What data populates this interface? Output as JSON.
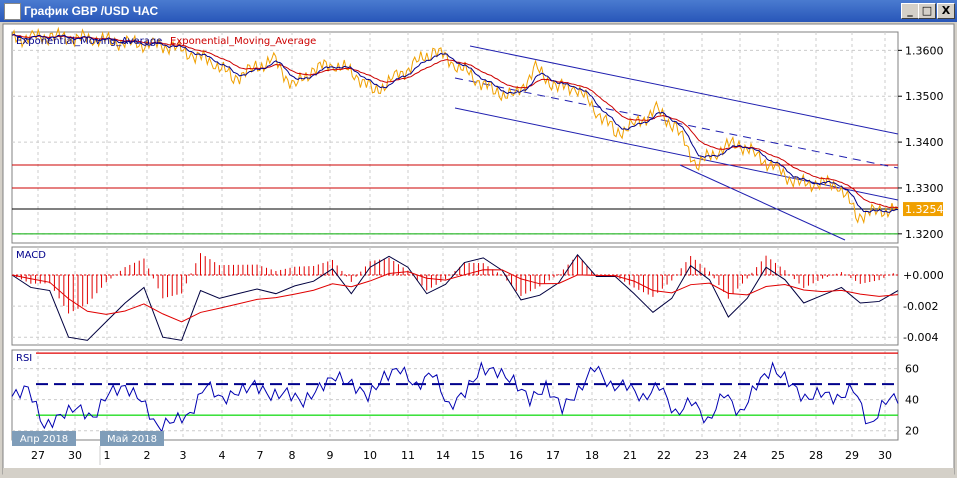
{
  "window": {
    "title": "График GBP /USD  ЧАС",
    "buttons": [
      "_",
      "□",
      "X"
    ]
  },
  "chart_data": [
    {
      "type": "line",
      "panel": "price",
      "legend": [
        "Exponential_Moving_Average",
        "Exponential_Moving_Average"
      ],
      "legend_colors": [
        "#00008b",
        "#cc0000"
      ],
      "ylim": [
        1.318,
        1.364
      ],
      "yticks": [
        "1.3600",
        "1.3500",
        "1.3400",
        "1.3300",
        "1.3200"
      ],
      "current_price": "1.3254",
      "price_color": "#f0a000",
      "hlines": [
        {
          "value": 1.335,
          "color": "#cc0000"
        },
        {
          "value": 1.33,
          "color": "#cc0000"
        },
        {
          "value": 1.3254,
          "color": "#000000"
        },
        {
          "value": 1.32,
          "color": "#00aa00"
        }
      ],
      "close": [
        1.3625,
        1.3628,
        1.363,
        1.3627,
        1.3626,
        1.362,
        1.3615,
        1.3612,
        1.3608,
        1.359,
        1.3575,
        1.354,
        1.356,
        1.358,
        1.352,
        1.356,
        1.357,
        1.355,
        1.351,
        1.354,
        1.357,
        1.36,
        1.357,
        1.354,
        1.351,
        1.35,
        1.356,
        1.352,
        1.352,
        1.347,
        1.342,
        1.344,
        1.347,
        1.343,
        1.335,
        1.338,
        1.34,
        1.337,
        1.334,
        1.331,
        1.331,
        1.331,
        1.324,
        1.325,
        1.3254
      ]
    },
    {
      "type": "line",
      "panel": "macd",
      "label": "MACD",
      "ylim": [
        -0.0045,
        0.0018
      ],
      "yticks": [
        "+0.000",
        "-0.002",
        "-0.004"
      ],
      "macd": [
        0,
        -0.0008,
        -0.001,
        -0.004,
        -0.0042,
        -0.003,
        -0.0018,
        -0.0008,
        -0.004,
        -0.0042,
        -0.001,
        -0.0015,
        -0.0012,
        -0.0009,
        -0.0012,
        -0.0007,
        -0.0004,
        0.0004,
        -0.0012,
        0.0005,
        0.0012,
        0.0005,
        -0.0012,
        -0.0006,
        0.0008,
        0.0011,
        0.0003,
        -0.0016,
        -0.0013,
        -0.0005,
        0.0013,
        -0.0001,
        -0.0001,
        -0.0012,
        -0.0024,
        -0.0015,
        0.0006,
        -0.0003,
        -0.0027,
        -0.0015,
        0.0005,
        -0.0003,
        -0.0018,
        -0.0013,
        -0.0008,
        -0.0018,
        -0.0017,
        -0.001
      ]
    },
    {
      "type": "line",
      "panel": "rsi",
      "label": "RSI",
      "ylim": [
        14,
        72
      ],
      "yticks": [
        "60",
        "40",
        "20"
      ],
      "levels": [
        70,
        50,
        30
      ],
      "rsi": [
        42,
        48,
        22,
        30,
        35,
        28,
        45,
        48,
        40,
        22,
        27,
        30,
        50,
        40,
        45,
        50,
        42,
        45,
        38,
        48,
        55,
        50,
        42,
        55,
        60,
        48,
        58,
        35,
        45,
        60,
        58,
        52,
        40,
        48,
        35,
        45,
        62,
        48,
        50,
        40,
        50,
        30,
        40,
        25,
        45,
        30,
        50,
        60,
        52,
        40,
        45,
        40,
        48,
        22,
        40,
        42
      ]
    },
    {
      "type": "axis",
      "xticks": [
        "27",
        "30",
        "1",
        "2",
        "3",
        "4",
        "7",
        "8",
        "9",
        "10",
        "11",
        "14",
        "15",
        "16",
        "17",
        "18",
        "21",
        "22",
        "23",
        "24",
        "25",
        "28",
        "29",
        "30"
      ],
      "month_labels": [
        "Апр 2018",
        "Май 2018"
      ]
    }
  ]
}
